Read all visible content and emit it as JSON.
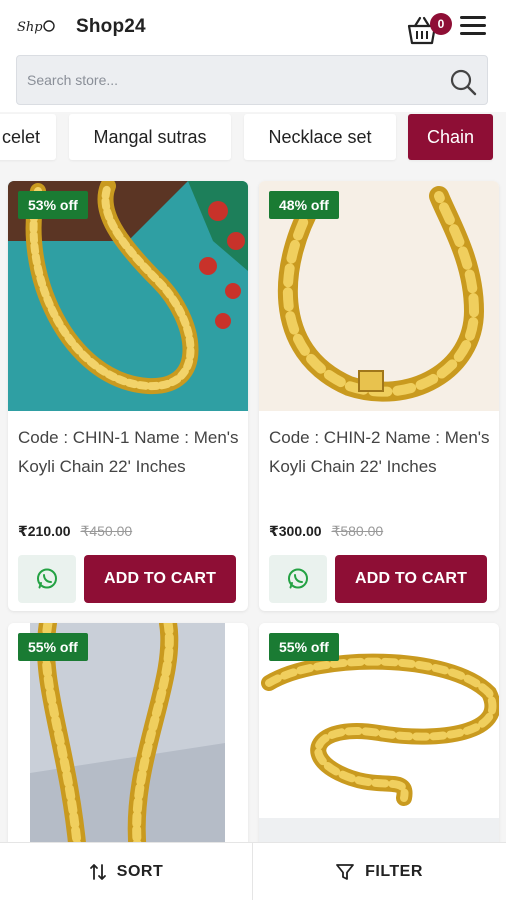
{
  "header": {
    "logo_text": "Shop24",
    "store_name": "Shop24",
    "cart_count": "0"
  },
  "search": {
    "placeholder": "Search store..."
  },
  "categories": [
    {
      "label": "celet"
    },
    {
      "label": "Mangal sutras"
    },
    {
      "label": "Necklace set"
    },
    {
      "label": "Chain",
      "active": true
    }
  ],
  "products": [
    {
      "discount": "53% off",
      "title": "Code : CHIN-1 Name : Men's Koyli Chain 22' Inches",
      "price": "₹210.00",
      "mrp": "₹450.00",
      "add_to_cart": "ADD TO CART"
    },
    {
      "discount": "48% off",
      "title": "Code : CHIN-2 Name : Men's Koyli Chain 22' Inches",
      "price": "₹300.00",
      "mrp": "₹580.00",
      "add_to_cart": "ADD TO CART"
    },
    {
      "discount": "55% off"
    },
    {
      "discount": "55% off"
    }
  ],
  "bottom_bar": {
    "sort_label": "SORT",
    "filter_label": "FILTER"
  },
  "colors": {
    "accent": "#8e0e35",
    "discount_badge": "#1a7b33",
    "whatsapp": "#25a244"
  }
}
